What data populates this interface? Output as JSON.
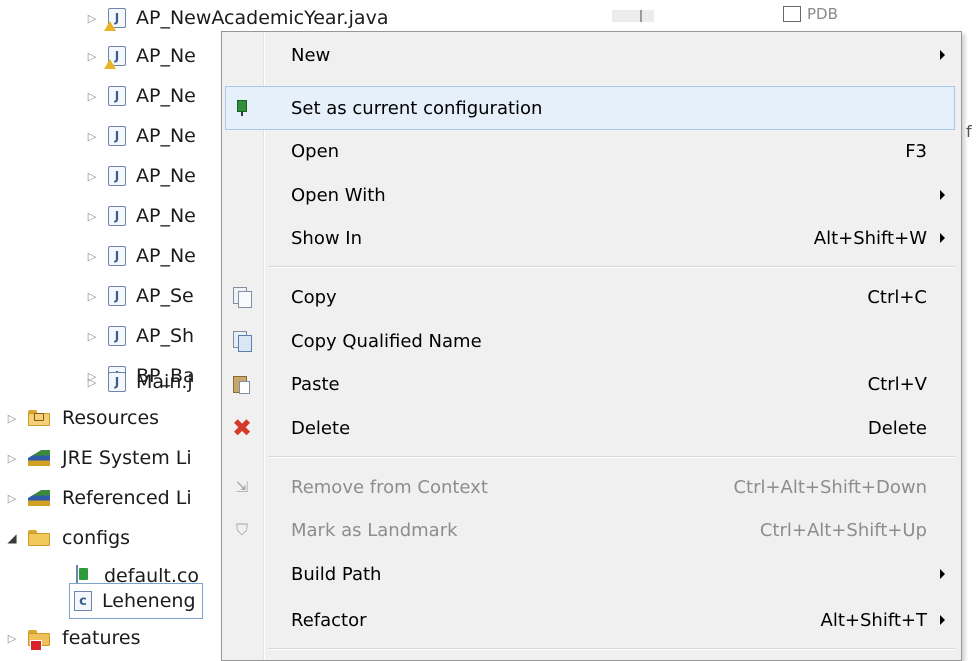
{
  "tree": {
    "top_partial_label": "AP_NewAcademicYear.java",
    "java_files": [
      {
        "label": "AP_Ne",
        "warning": true
      },
      {
        "label": "AP_Ne",
        "warning": false
      },
      {
        "label": "AP_Ne",
        "warning": false
      },
      {
        "label": "AP_Ne",
        "warning": false
      },
      {
        "label": "AP_Ne",
        "warning": false
      },
      {
        "label": "AP_Ne",
        "warning": false
      },
      {
        "label": "AP_Se",
        "warning": false
      },
      {
        "label": "AP_Sh",
        "warning": false
      },
      {
        "label": "BP_Ba",
        "warning": false
      },
      {
        "label": "Main.j",
        "warning": false
      }
    ],
    "folders": {
      "resources": "Resources",
      "jre": "JRE System Li",
      "referenced": "Referenced Li",
      "configs": "configs",
      "default_config": "default.co",
      "selected_config": "Leheneng",
      "features": "features"
    },
    "right_panel": {
      "pdb_label": "PDB",
      "edge_char": "f"
    }
  },
  "menu": {
    "items": [
      {
        "label": "New",
        "accel": "",
        "submenu": true,
        "icon": "",
        "disabled": false
      },
      {
        "label": "Set as current configuration",
        "accel": "",
        "submenu": false,
        "icon": "config-pin-icon",
        "disabled": false
      },
      {
        "label": "Open",
        "accel": "F3",
        "submenu": false,
        "icon": "",
        "disabled": false
      },
      {
        "label": "Open With",
        "accel": "",
        "submenu": true,
        "icon": "",
        "disabled": false
      },
      {
        "label": "Show In",
        "accel": "Alt+Shift+W",
        "submenu": true,
        "icon": "",
        "disabled": false
      },
      {
        "label": "Copy",
        "accel": "Ctrl+C",
        "submenu": false,
        "icon": "copy-icon",
        "disabled": false
      },
      {
        "label": "Copy Qualified Name",
        "accel": "",
        "submenu": false,
        "icon": "copy-qualified-name-icon",
        "disabled": false
      },
      {
        "label": "Paste",
        "accel": "Ctrl+V",
        "submenu": false,
        "icon": "paste-icon",
        "disabled": false
      },
      {
        "label": "Delete",
        "accel": "Delete",
        "submenu": false,
        "icon": "delete-icon",
        "disabled": false
      },
      {
        "label": "Remove from Context",
        "accel": "Ctrl+Alt+Shift+Down",
        "submenu": false,
        "icon": "remove-from-context-icon",
        "disabled": true
      },
      {
        "label": "Mark as Landmark",
        "accel": "Ctrl+Alt+Shift+Up",
        "submenu": false,
        "icon": "landmark-icon",
        "disabled": true
      },
      {
        "label": "Build Path",
        "accel": "",
        "submenu": true,
        "icon": "",
        "disabled": false
      },
      {
        "label": "Refactor",
        "accel": "Alt+Shift+T",
        "submenu": true,
        "icon": "",
        "disabled": false
      }
    ],
    "hovered_item": "Set as current configuration"
  }
}
